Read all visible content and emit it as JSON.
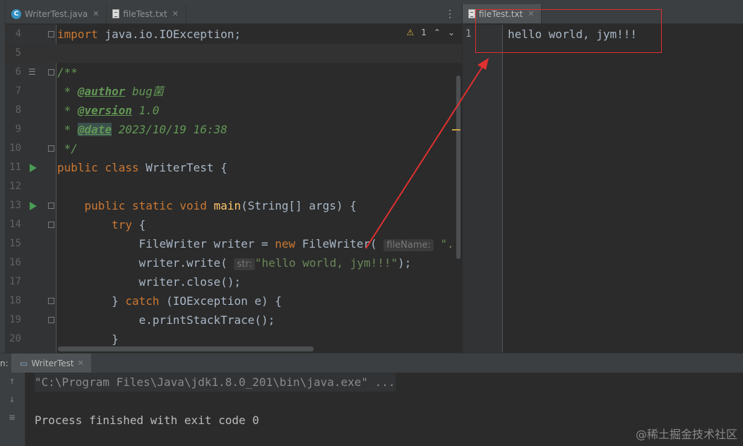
{
  "editor_tabs": [
    {
      "label": "WriterTest.java",
      "icon": "java-class-icon",
      "active": false
    },
    {
      "label": "fileTest.txt",
      "icon": "text-file-icon",
      "active": false
    }
  ],
  "right_tab": {
    "label": "fileTest.txt",
    "icon": "text-file-icon"
  },
  "inspection": {
    "warnings": "1"
  },
  "code_lines": [
    {
      "num": "4",
      "text": "import java.io.IOException;"
    },
    {
      "num": "5",
      "text": ""
    },
    {
      "num": "6",
      "text": "/**"
    },
    {
      "num": "7",
      "text": " * @author bug菌"
    },
    {
      "num": "8",
      "text": " * @version 1.0"
    },
    {
      "num": "9",
      "text": " * @date 2023/10/19 16:38"
    },
    {
      "num": "10",
      "text": " */"
    },
    {
      "num": "11",
      "text": "public class WriterTest {"
    },
    {
      "num": "12",
      "text": ""
    },
    {
      "num": "13",
      "text": "    public static void main(String[] args) {"
    },
    {
      "num": "14",
      "text": "        try {"
    },
    {
      "num": "15",
      "text": "            FileWriter writer = new FileWriter( fileName: \"."
    },
    {
      "num": "16",
      "text": "            writer.write( str: \"hello world, jym!!!\");"
    },
    {
      "num": "17",
      "text": "            writer.close();"
    },
    {
      "num": "18",
      "text": "        } catch (IOException e) {"
    },
    {
      "num": "19",
      "text": "            e.printStackTrace();"
    },
    {
      "num": "20",
      "text": "        }"
    }
  ],
  "hints": {
    "fileName": "fileName:",
    "str": "str:"
  },
  "file_content": {
    "num": "1",
    "text": "hello world, jym!!!"
  },
  "run_panel": {
    "label": "n:",
    "tab": "WriterTest"
  },
  "console": {
    "command": "\"C:\\Program Files\\Java\\jdk1.8.0_201\\bin\\java.exe\" ...",
    "output": "Process finished with exit code 0"
  },
  "watermark": "@稀土掘金技术社区",
  "colors": {
    "keyword": "#cc7832",
    "string": "#6a8759",
    "comment": "#629755",
    "function": "#ffc66d",
    "annotation_box": "#e03030"
  }
}
